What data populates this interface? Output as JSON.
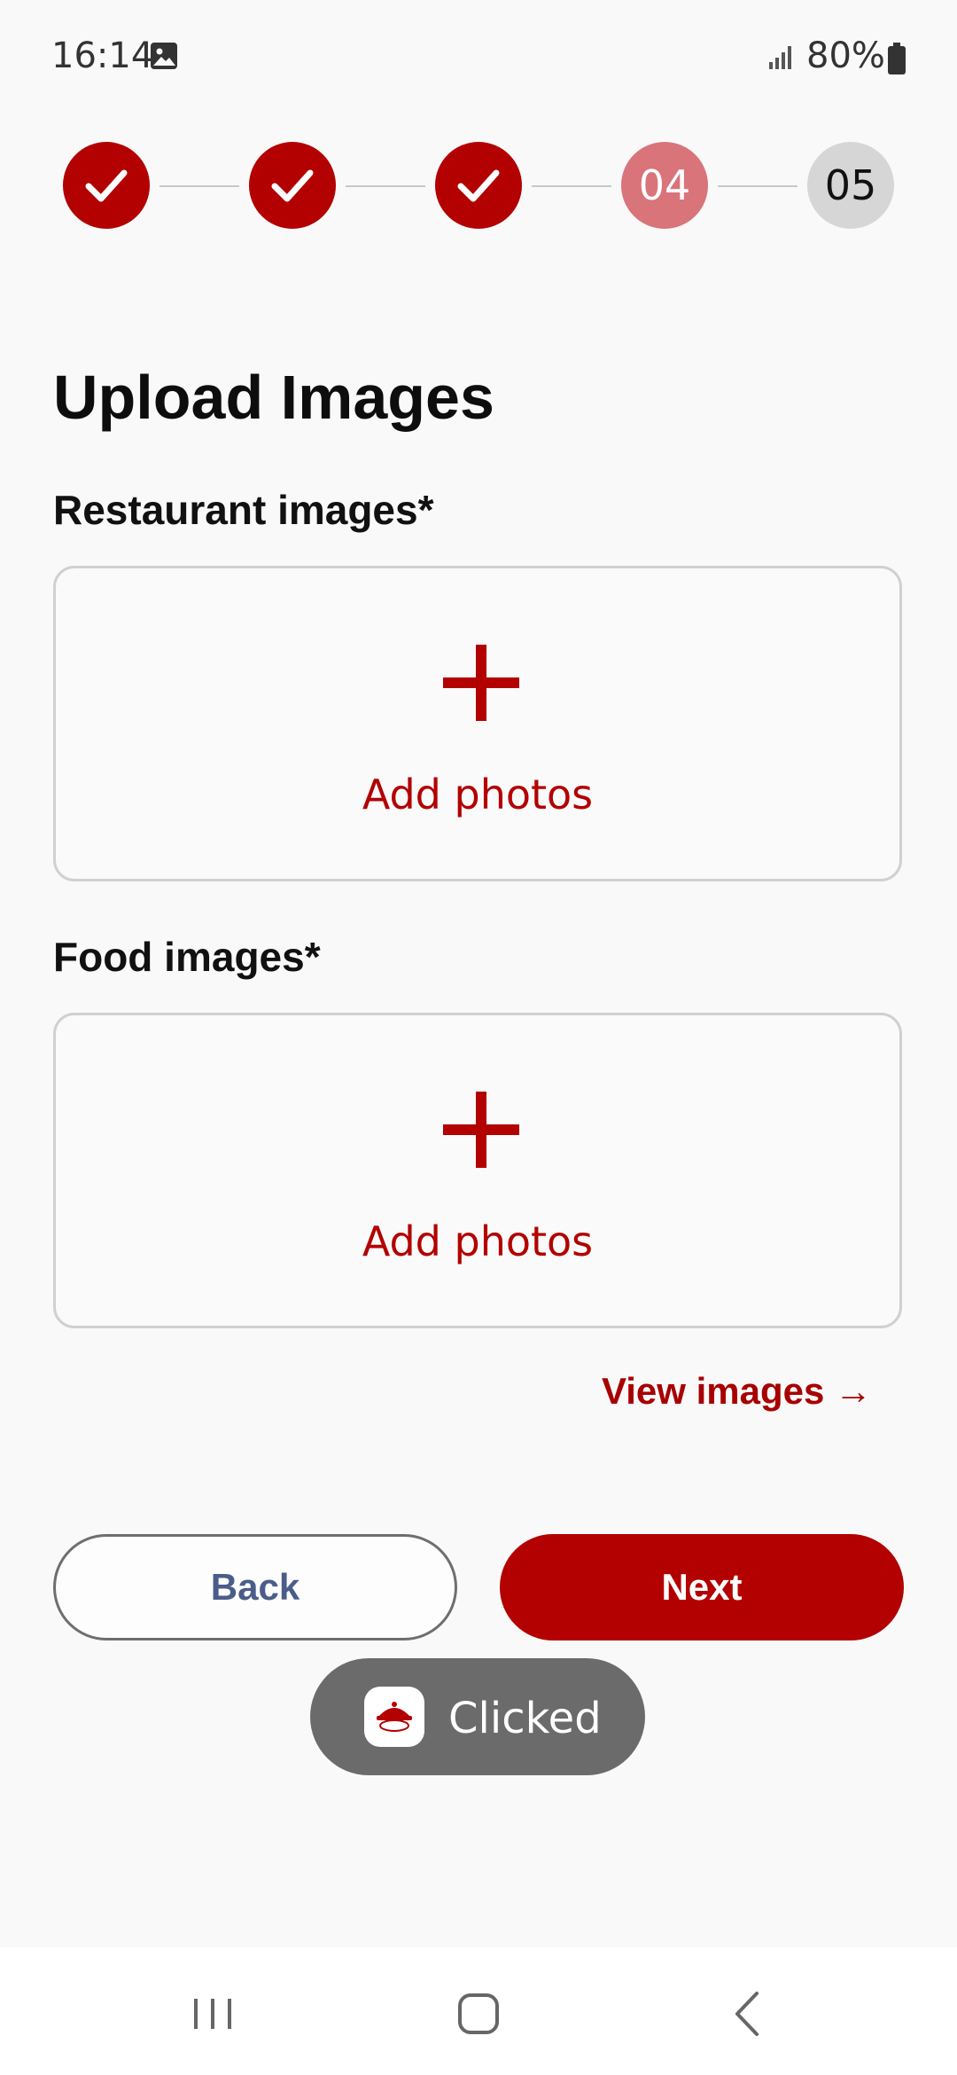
{
  "status_bar": {
    "time": "16:14",
    "battery": "80%",
    "icons": [
      "gallery-notification-icon",
      "signal-icon",
      "battery-icon"
    ]
  },
  "stepper": {
    "steps": [
      {
        "label": "",
        "state": "done",
        "icon": "check-icon"
      },
      {
        "label": "",
        "state": "done",
        "icon": "check-icon"
      },
      {
        "label": "",
        "state": "done",
        "icon": "check-icon"
      },
      {
        "label": "04",
        "state": "current"
      },
      {
        "label": "05",
        "state": "upcoming"
      }
    ]
  },
  "page": {
    "title": "Upload Images",
    "restaurant_label": "Restaurant images*",
    "restaurant_add": "Add photos",
    "food_label": "Food images*",
    "food_add": "Add photos",
    "view_images": "View images →"
  },
  "actions": {
    "back": "Back",
    "next": "Next"
  },
  "toast": {
    "text": "Clicked",
    "icon": "app-logo-icon"
  },
  "nav_bar": {
    "icons": [
      "recent-apps-icon",
      "home-icon",
      "back-icon"
    ]
  },
  "colors": {
    "accent": "#b30000",
    "current_step": "#d9747b",
    "upcoming_step": "#d6d6d6",
    "back_text": "#4a5d8a"
  }
}
